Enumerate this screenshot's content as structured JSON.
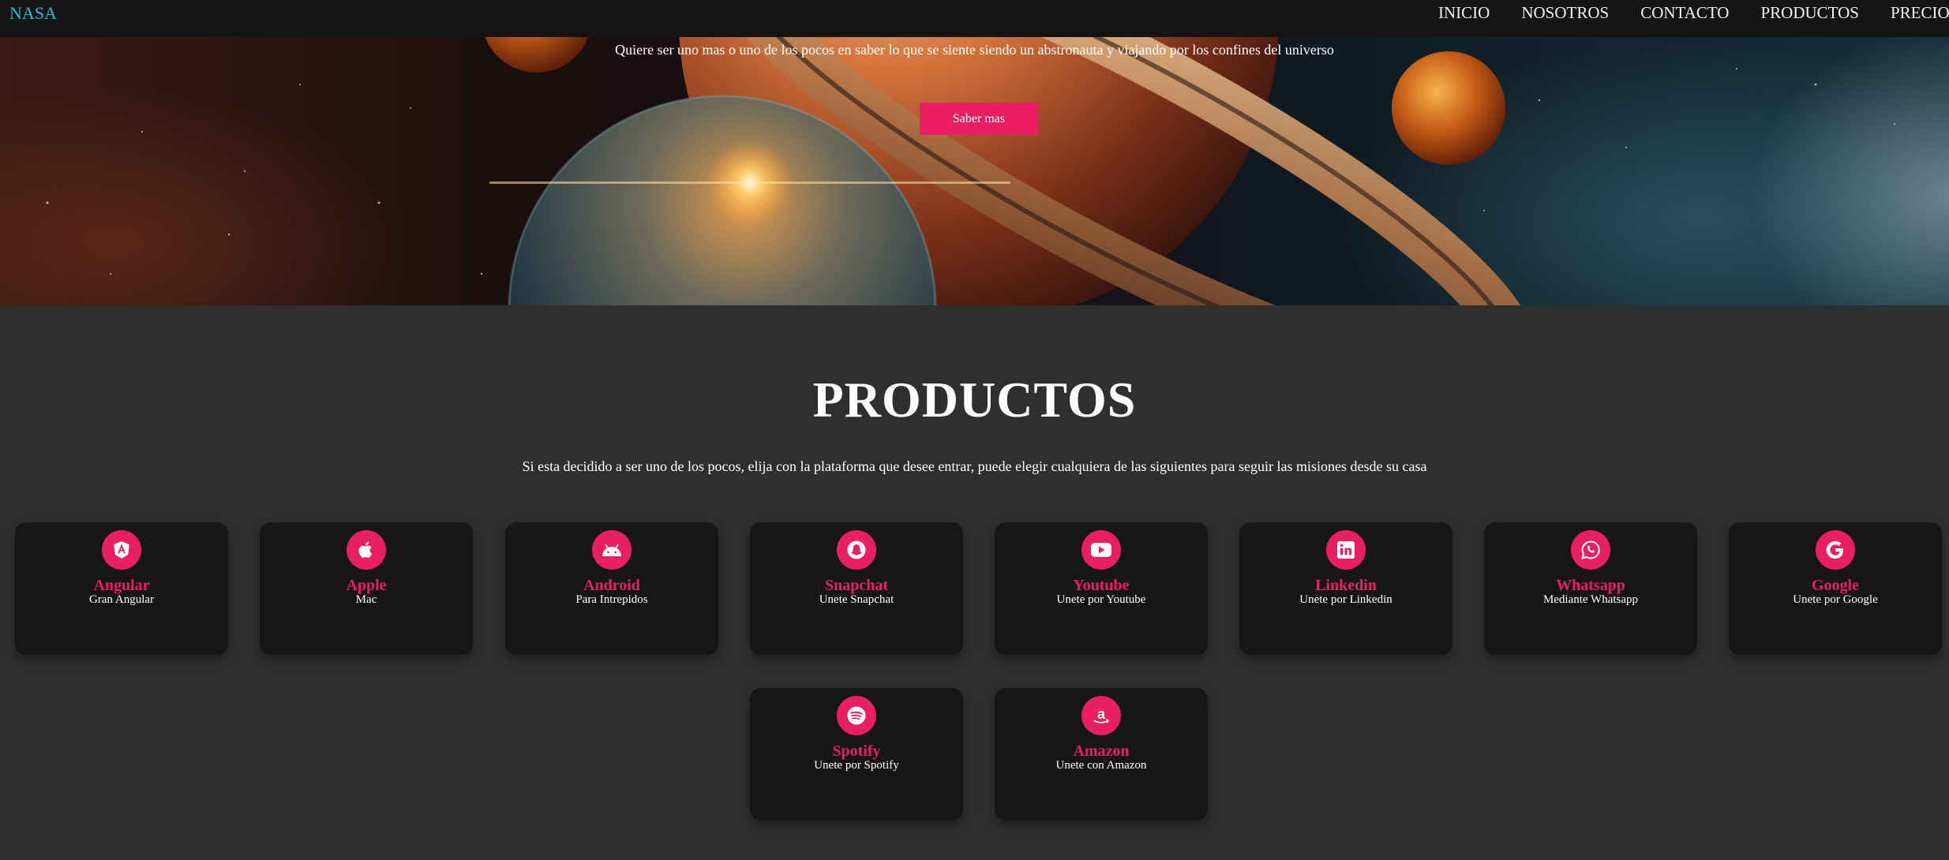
{
  "navbar": {
    "brand": "NASA",
    "links": [
      "INICIO",
      "NOSOTROS",
      "CONTACTO",
      "PRODUCTOS",
      "PRECIO"
    ]
  },
  "hero": {
    "text": "Quiere ser uno mas o uno de los pocos en saber lo que se siente siendo un abstronauta y viajando por los confines del universo",
    "button": "Saber mas"
  },
  "products": {
    "title": "PRODUCTOS",
    "description": "Si esta decidido a ser uno de los pocos, elija con la plataforma que desee entrar, puede elegir cualquiera de las siguientes para seguir las misiones desde su casa",
    "items": [
      {
        "icon": "angular-icon",
        "title": "Angular",
        "subtitle": "Gran Angular"
      },
      {
        "icon": "apple-icon",
        "title": "Apple",
        "subtitle": "Mac"
      },
      {
        "icon": "android-icon",
        "title": "Android",
        "subtitle": "Para Intrepidos"
      },
      {
        "icon": "snapchat-icon",
        "title": "Snapchat",
        "subtitle": "Unete Snapchat"
      },
      {
        "icon": "youtube-icon",
        "title": "Youtube",
        "subtitle": "Unete por Youtube"
      },
      {
        "icon": "linkedin-icon",
        "title": "Linkedin",
        "subtitle": "Unete por Linkedin"
      },
      {
        "icon": "whatsapp-icon",
        "title": "Whatsapp",
        "subtitle": "Mediante Whatsapp"
      },
      {
        "icon": "google-icon",
        "title": "Google",
        "subtitle": "Unete por Google"
      },
      {
        "icon": "spotify-icon",
        "title": "Spotify",
        "subtitle": "Unete por Spotify"
      },
      {
        "icon": "amazon-icon",
        "title": "Amazon",
        "subtitle": "Unete con Amazon"
      }
    ]
  },
  "colors": {
    "accent": "#e91e63",
    "brand": "#1ec1d6",
    "navbar": "#141414",
    "background": "#2f2f2f",
    "card": "#161616"
  }
}
